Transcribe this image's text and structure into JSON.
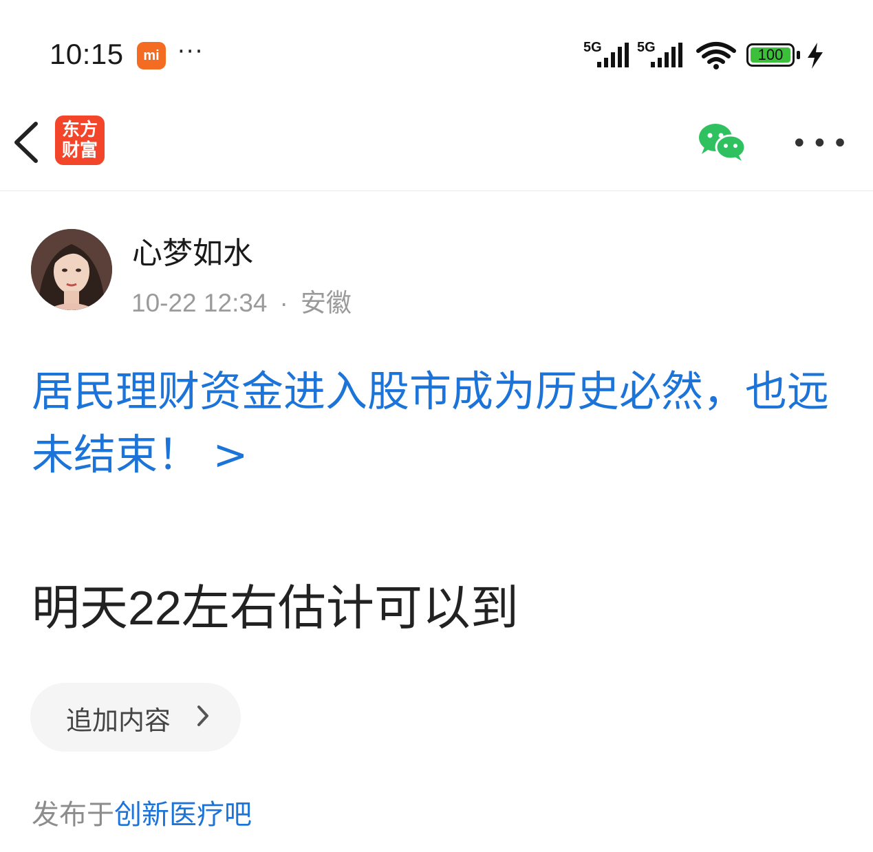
{
  "status_bar": {
    "time": "10:15",
    "mi_badge": "mi",
    "notification_more": "···",
    "signal1_label": "5G",
    "signal2_label": "5G",
    "battery": "100",
    "battery_color": "#3cc03c"
  },
  "nav": {
    "logo_line1": "东方",
    "logo_line2": "财富",
    "logo_color": "#f3452a",
    "more": "•••"
  },
  "post": {
    "author": "心梦如水",
    "date": "10-22 12:34",
    "separator": "·",
    "location": "安徽",
    "link_title": "居民理财资金进入股市成为历史必然，也远未结束！ >",
    "link_color": "#1c74d9",
    "body": "明天22左右估计可以到",
    "add_content": "追加内容",
    "posted_prefix": "发布于",
    "forum": "创新医疗吧"
  }
}
